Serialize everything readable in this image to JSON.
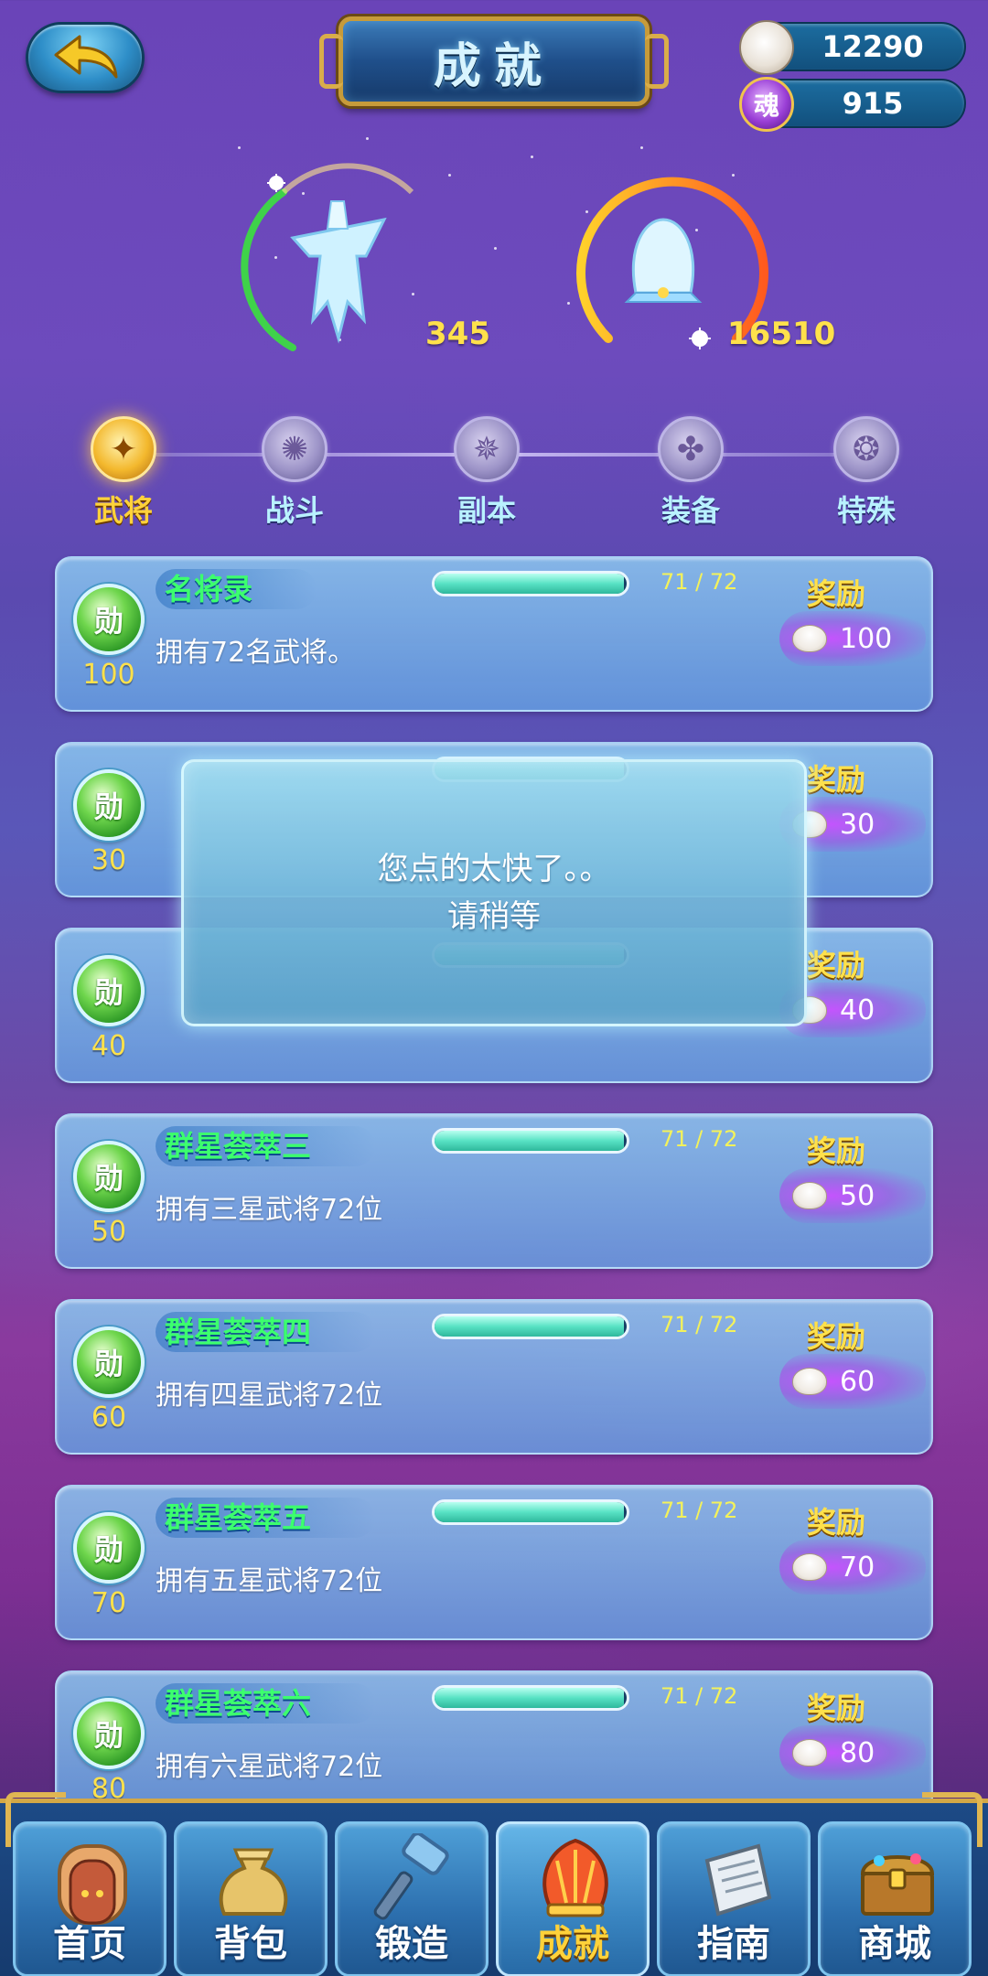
{
  "header": {
    "title": "成就",
    "back_icon": "back-arrow-icon"
  },
  "currency": {
    "buns": {
      "icon": "steamed-bun-icon",
      "value": "12290"
    },
    "soul": {
      "icon": "soul-orb-icon",
      "glyph": "魂",
      "value": "915"
    }
  },
  "trophies": [
    {
      "icon": "bronze-vessel-icon",
      "value": "345"
    },
    {
      "icon": "shell-crown-icon",
      "value": "16510"
    }
  ],
  "tabs": [
    {
      "label": "武将",
      "icon": "general-icon",
      "active": true
    },
    {
      "label": "战斗",
      "icon": "battle-icon",
      "active": false
    },
    {
      "label": "副本",
      "icon": "dungeon-icon",
      "active": false
    },
    {
      "label": "装备",
      "icon": "equipment-icon",
      "active": false
    },
    {
      "label": "特殊",
      "icon": "special-icon",
      "active": false
    }
  ],
  "reward_label": "奖励",
  "badge_glyph": "勋",
  "achievements": [
    {
      "name": "名将录",
      "progress_text": "71 / 72",
      "progress": 0.986,
      "desc": "拥有72名武将。",
      "points": "100",
      "reward": "100"
    },
    {
      "name": "",
      "progress_text": "",
      "progress": 0.986,
      "desc": "",
      "points": "30",
      "reward": "30"
    },
    {
      "name": "",
      "progress_text": "",
      "progress": 0.986,
      "desc": "",
      "points": "40",
      "reward": "40"
    },
    {
      "name": "群星荟萃三",
      "progress_text": "71 / 72",
      "progress": 0.986,
      "desc": "拥有三星武将72位",
      "points": "50",
      "reward": "50"
    },
    {
      "name": "群星荟萃四",
      "progress_text": "71 / 72",
      "progress": 0.986,
      "desc": "拥有四星武将72位",
      "points": "60",
      "reward": "60"
    },
    {
      "name": "群星荟萃五",
      "progress_text": "71 / 72",
      "progress": 0.986,
      "desc": "拥有五星武将72位",
      "points": "70",
      "reward": "70"
    },
    {
      "name": "群星荟萃六",
      "progress_text": "71 / 72",
      "progress": 0.986,
      "desc": "拥有六星武将72位",
      "points": "80",
      "reward": "80"
    }
  ],
  "popup": {
    "line1": "您点的太快了。。",
    "line2": "请稍等"
  },
  "nav": [
    {
      "label": "首页",
      "icon": "gate-door-icon",
      "active": false
    },
    {
      "label": "背包",
      "icon": "bag-icon",
      "active": false
    },
    {
      "label": "锻造",
      "icon": "hammer-icon",
      "active": false
    },
    {
      "label": "成就",
      "icon": "achievement-shell-icon",
      "active": true
    },
    {
      "label": "指南",
      "icon": "scroll-map-icon",
      "active": false
    },
    {
      "label": "商城",
      "icon": "treasure-chest-icon",
      "active": false
    }
  ],
  "colors": {
    "accent_gold": "#ffe14b",
    "progress_fill": "#58e2c4",
    "name_green": "#3cff6e"
  }
}
